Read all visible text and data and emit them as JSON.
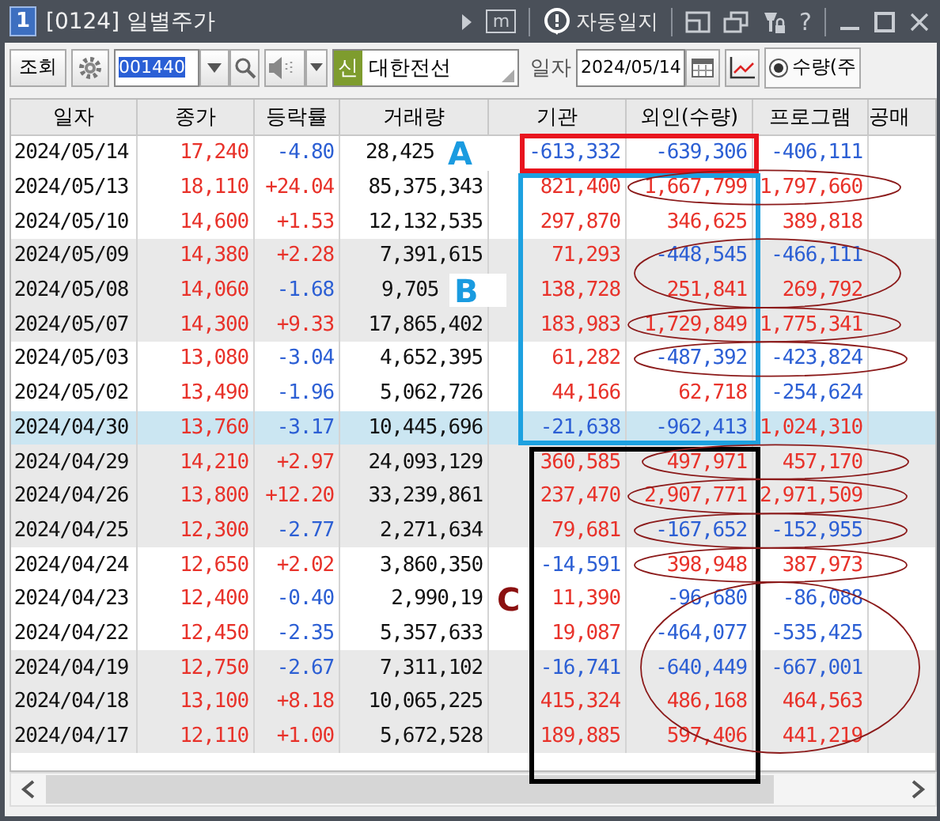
{
  "window": {
    "number": "1",
    "title": "[0124] 일별주가",
    "memo": "m",
    "auto_log": "자동일지",
    "help": "?"
  },
  "toolbar": {
    "query_button": "조회",
    "code": "001440",
    "market_badge": "신",
    "name": "대한전선",
    "date_label": "일자",
    "date": "2024/05/14",
    "radio": {
      "label": "수량(주",
      "selected": true
    }
  },
  "table": {
    "columns": [
      "일자",
      "종가",
      "등락률",
      "거래량",
      "기관",
      "외인(수량)",
      "프로그램",
      "공매"
    ],
    "rows": [
      {
        "date": "2024/05/14",
        "close": "17,240",
        "change": "-4.80",
        "volume": "28,425",
        "institution": "-613,332",
        "foreign": "-639,306",
        "program": "-406,111",
        "selected": false
      },
      {
        "date": "2024/05/13",
        "close": "18,110",
        "change": "+24.04",
        "volume": "85,375,343",
        "institution": "821,400",
        "foreign": "1,667,799",
        "program": "1,797,660",
        "selected": false
      },
      {
        "date": "2024/05/10",
        "close": "14,600",
        "change": "+1.53",
        "volume": "12,132,535",
        "institution": "297,870",
        "foreign": "346,625",
        "program": "389,818",
        "selected": false
      },
      {
        "date": "2024/05/09",
        "close": "14,380",
        "change": "+2.28",
        "volume": "7,391,615",
        "institution": "71,293",
        "foreign": "-448,545",
        "program": "-466,111",
        "selected": false
      },
      {
        "date": "2024/05/08",
        "close": "14,060",
        "change": "-1.68",
        "volume": "9,705",
        "institution": "138,728",
        "foreign": "251,841",
        "program": "269,792",
        "selected": false
      },
      {
        "date": "2024/05/07",
        "close": "14,300",
        "change": "+9.33",
        "volume": "17,865,402",
        "institution": "183,983",
        "foreign": "1,729,849",
        "program": "1,775,341",
        "selected": false
      },
      {
        "date": "2024/05/03",
        "close": "13,080",
        "change": "-3.04",
        "volume": "4,652,395",
        "institution": "61,282",
        "foreign": "-487,392",
        "program": "-423,824",
        "selected": false
      },
      {
        "date": "2024/05/02",
        "close": "13,490",
        "change": "-1.96",
        "volume": "5,062,726",
        "institution": "44,166",
        "foreign": "62,718",
        "program": "-254,624",
        "selected": false
      },
      {
        "date": "2024/04/30",
        "close": "13,760",
        "change": "-3.17",
        "volume": "10,445,696",
        "institution": "-21,638",
        "foreign": "-962,413",
        "program": "1,024,310",
        "selected": true
      },
      {
        "date": "2024/04/29",
        "close": "14,210",
        "change": "+2.97",
        "volume": "24,093,129",
        "institution": "360,585",
        "foreign": "497,971",
        "program": "457,170",
        "selected": false
      },
      {
        "date": "2024/04/26",
        "close": "13,800",
        "change": "+12.20",
        "volume": "33,239,861",
        "institution": "237,470",
        "foreign": "2,907,771",
        "program": "2,971,509",
        "selected": false
      },
      {
        "date": "2024/04/25",
        "close": "12,300",
        "change": "-2.77",
        "volume": "2,271,634",
        "institution": "79,681",
        "foreign": "-167,652",
        "program": "-152,955",
        "selected": false
      },
      {
        "date": "2024/04/24",
        "close": "12,650",
        "change": "+2.02",
        "volume": "3,860,350",
        "institution": "-14,591",
        "foreign": "398,948",
        "program": "387,973",
        "selected": false
      },
      {
        "date": "2024/04/23",
        "close": "12,400",
        "change": "-0.40",
        "volume": "2,990,19",
        "institution": "11,390",
        "foreign": "-96,680",
        "program": "-86,088",
        "selected": false
      },
      {
        "date": "2024/04/22",
        "close": "12,450",
        "change": "-2.35",
        "volume": "5,357,633",
        "institution": "19,087",
        "foreign": "-464,077",
        "program": "-535,425",
        "selected": false
      },
      {
        "date": "2024/04/19",
        "close": "12,750",
        "change": "-2.67",
        "volume": "7,311,102",
        "institution": "-16,741",
        "foreign": "-640,449",
        "program": "-667,001",
        "selected": false
      },
      {
        "date": "2024/04/18",
        "close": "13,100",
        "change": "+8.18",
        "volume": "10,065,225",
        "institution": "415,324",
        "foreign": "486,168",
        "program": "464,563",
        "selected": false
      },
      {
        "date": "2024/04/17",
        "close": "12,110",
        "change": "+1.00",
        "volume": "5,672,528",
        "institution": "189,885",
        "foreign": "597,406",
        "program": "441,219",
        "selected": false
      }
    ]
  },
  "annotations": {
    "labels": [
      {
        "text": "A",
        "color": "#1a9be0"
      },
      {
        "text": "B",
        "color": "#1a9be0"
      },
      {
        "text": "C",
        "color": "#8b1010"
      }
    ]
  }
}
